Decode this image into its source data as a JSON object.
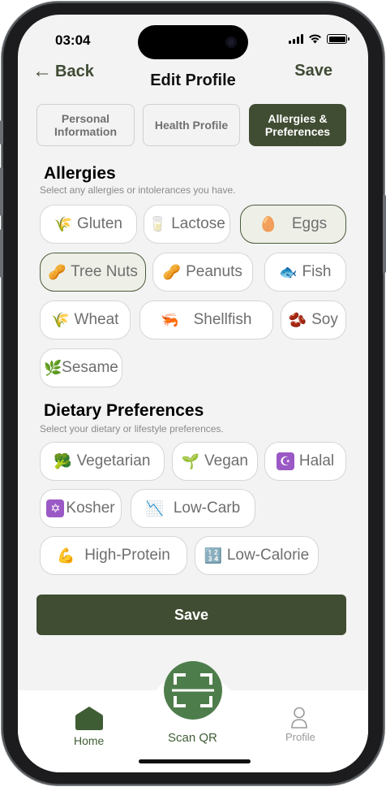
{
  "status": {
    "time": "03:04"
  },
  "header": {
    "back_label": "Back",
    "title": "Edit Profile",
    "save_label": "Save"
  },
  "tabs": [
    {
      "label_line1": "Personal",
      "label_line2": "Information"
    },
    {
      "label_line1": "Health Profile",
      "label_line2": ""
    },
    {
      "label_line1": "Allergies &",
      "label_line2": "Preferences"
    }
  ],
  "allergies": {
    "title": "Allergies",
    "subtitle": "Select any allergies or intolerances you have.",
    "items": [
      {
        "label": "Gluten",
        "icon": "🌾",
        "icon_name": "wheat-stalk-icon"
      },
      {
        "label": "Lactose",
        "icon": "🥛",
        "icon_name": "glass-of-milk-icon"
      },
      {
        "label": "Eggs",
        "icon": "🥚",
        "icon_name": "egg-icon"
      },
      {
        "label": "Tree Nuts",
        "icon": "🥜",
        "icon_name": "nut-icon"
      },
      {
        "label": "Peanuts",
        "icon": "🥜",
        "icon_name": "peanut-icon"
      },
      {
        "label": "Fish",
        "icon": "🐟",
        "icon_name": "fish-icon"
      },
      {
        "label": "Wheat",
        "icon": "🌾",
        "icon_name": "wheat-icon"
      },
      {
        "label": "Shellfish",
        "icon": "🦐",
        "icon_name": "shrimp-icon"
      },
      {
        "label": "Soy",
        "icon": "🫘",
        "icon_name": "beans-icon"
      },
      {
        "label": "Sesame",
        "icon": "🌿",
        "icon_name": "herb-icon"
      }
    ]
  },
  "dietary": {
    "title": "Dietary Preferences",
    "subtitle": "Select your dietary or lifestyle preferences.",
    "items": [
      {
        "label": "Vegetarian",
        "icon": "🥦",
        "icon_name": "broccoli-icon"
      },
      {
        "label": "Vegan",
        "icon": "🌱",
        "icon_name": "seedling-icon"
      },
      {
        "label": "Halal",
        "icon": "☪",
        "icon_name": "star-and-crescent-icon"
      },
      {
        "label": "Kosher",
        "icon": "✡",
        "icon_name": "star-of-david-icon"
      },
      {
        "label": "Low-Carb",
        "icon": "📉",
        "icon_name": "chart-decreasing-icon"
      },
      {
        "label": "High-Protein",
        "icon": "💪",
        "icon_name": "flexed-biceps-icon"
      },
      {
        "label": "Low-Calorie",
        "icon": "🔢",
        "icon_name": "numbers-icon"
      }
    ]
  },
  "save_button": "Save",
  "tabbar": {
    "home": "Home",
    "scan": "Scan QR",
    "profile": "Profile"
  },
  "colors": {
    "primary": "#414d33",
    "accent_green": "#4e7d4c",
    "selected_chip_bg": "#eef0e8",
    "background": "#f3f3f3"
  }
}
